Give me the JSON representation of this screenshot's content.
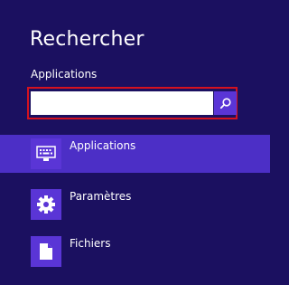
{
  "charm": {
    "title": "Rechercher",
    "scope_label": "Applications",
    "search": {
      "value": "",
      "placeholder": ""
    }
  },
  "results": [
    {
      "label": "Applications",
      "icon": "keyboard-icon",
      "selected": true
    },
    {
      "label": "Paramètres",
      "icon": "gear-icon",
      "selected": false
    },
    {
      "label": "Fichiers",
      "icon": "document-icon",
      "selected": false
    }
  ],
  "colors": {
    "background": "#1b1060",
    "accent": "#5a35d6",
    "selected_row": "#4c2fc6",
    "focus_border": "#d4121f"
  }
}
